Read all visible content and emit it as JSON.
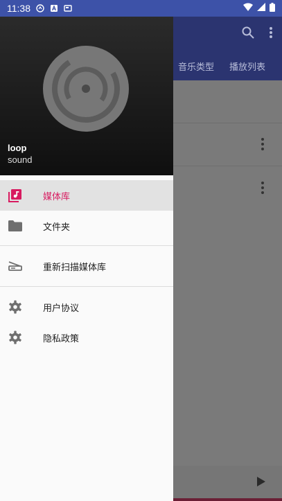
{
  "status_bar": {
    "time": "11:38"
  },
  "app": {
    "tabs": [
      "音乐类型",
      "播放列表"
    ]
  },
  "drawer": {
    "header": {
      "title": "loop",
      "subtitle": "sound"
    },
    "items": [
      {
        "label": "媒体库",
        "icon": "library-music-icon",
        "active": true
      },
      {
        "label": "文件夹",
        "icon": "folder-icon",
        "active": false
      },
      {
        "label": "重新扫描媒体库",
        "icon": "scanner-icon",
        "active": false
      },
      {
        "label": "用户协议",
        "icon": "settings-icon",
        "active": false
      },
      {
        "label": "隐私政策",
        "icon": "settings-icon",
        "active": false
      }
    ]
  },
  "colors": {
    "accent": "#d81b60",
    "app_bar": "#3d52a8"
  }
}
